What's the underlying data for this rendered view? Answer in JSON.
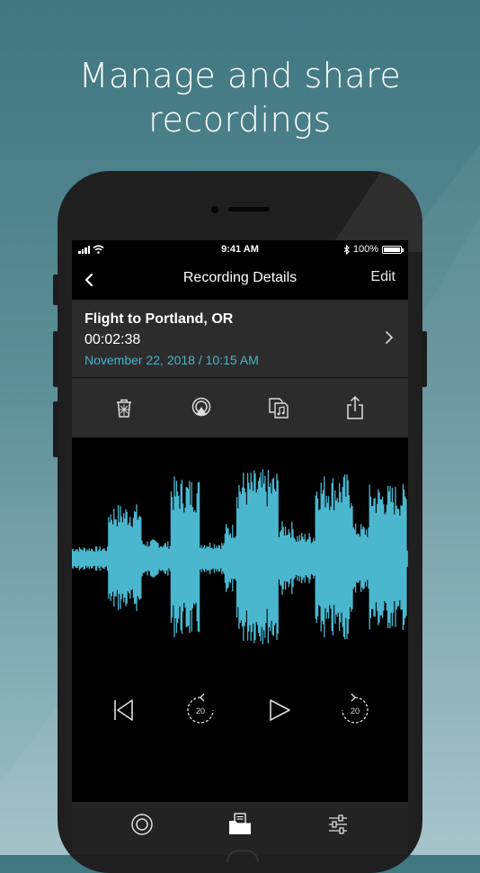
{
  "headline": {
    "line1": "Manage and share",
    "line2": "recordings"
  },
  "status_bar": {
    "time": "9:41 AM",
    "battery": "100%"
  },
  "nav": {
    "title": "Recording Details",
    "edit_label": "Edit"
  },
  "recording": {
    "name": "Flight to Portland, OR",
    "duration": "00:02:38",
    "date": "November 22, 2018 / 10:15 AM"
  },
  "actions": [
    "trash-icon",
    "airplay-icon",
    "convert-audio-icon",
    "share-icon"
  ],
  "transport": {
    "skip_back_seconds": "20",
    "skip_forward_seconds": "20"
  },
  "tabs": [
    "record-tab-icon",
    "recordings-tab-icon",
    "settings-tab-icon"
  ],
  "colors": {
    "accent": "#48b3d1",
    "waveform": "#4ab7cf",
    "panel": "#2c2c2c"
  }
}
